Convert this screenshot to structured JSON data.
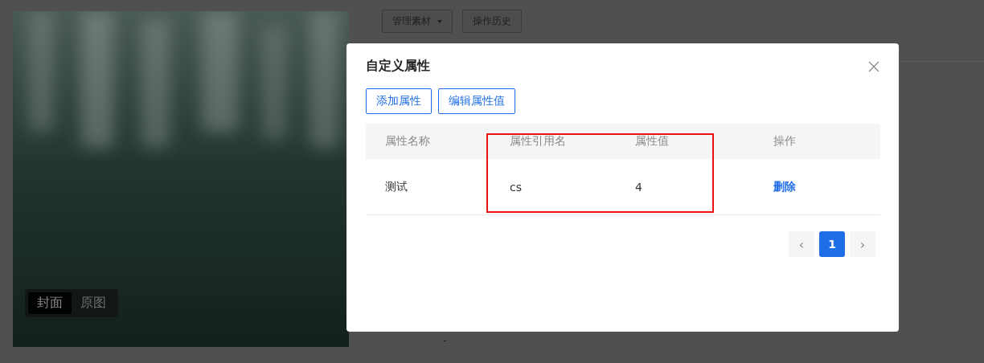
{
  "toolbar": {
    "buttons": [
      {
        "label": "管理素材",
        "dropdown": true
      },
      {
        "label": "操作历史",
        "dropdown": false
      }
    ]
  },
  "preview": {
    "tabs": [
      {
        "label": "封面",
        "selected": true
      },
      {
        "label": "原图",
        "selected": false
      }
    ]
  },
  "background_value": "-",
  "dialog": {
    "title": "自定义属性",
    "actions": [
      "添加属性",
      "编辑属性值"
    ],
    "table": {
      "columns": [
        "属性名称",
        "属性引用名",
        "属性值",
        "操作"
      ],
      "rows": [
        {
          "cells": [
            "测试",
            "cs",
            "4"
          ],
          "action": "删除"
        }
      ]
    },
    "pagination": {
      "prev": {
        "label": "‹",
        "disabled": true
      },
      "pages": [
        {
          "label": "1",
          "selected": true
        }
      ],
      "next": {
        "label": "›",
        "disabled": true
      }
    }
  }
}
